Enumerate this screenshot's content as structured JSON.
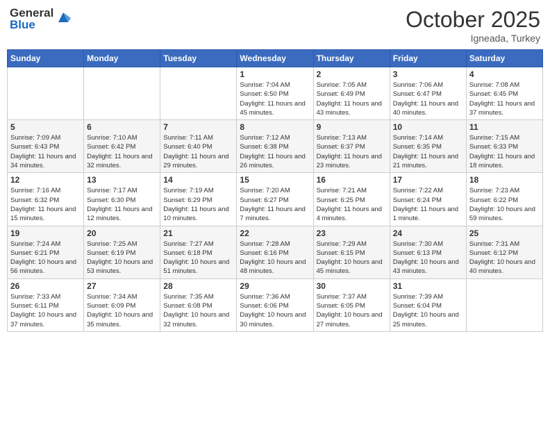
{
  "header": {
    "logo_general": "General",
    "logo_blue": "Blue",
    "month": "October 2025",
    "location": "Igneada, Turkey"
  },
  "weekdays": [
    "Sunday",
    "Monday",
    "Tuesday",
    "Wednesday",
    "Thursday",
    "Friday",
    "Saturday"
  ],
  "weeks": [
    [
      null,
      null,
      null,
      {
        "day": "1",
        "sunrise": "7:04 AM",
        "sunset": "6:50 PM",
        "daylight": "11 hours and 45 minutes."
      },
      {
        "day": "2",
        "sunrise": "7:05 AM",
        "sunset": "6:49 PM",
        "daylight": "11 hours and 43 minutes."
      },
      {
        "day": "3",
        "sunrise": "7:06 AM",
        "sunset": "6:47 PM",
        "daylight": "11 hours and 40 minutes."
      },
      {
        "day": "4",
        "sunrise": "7:08 AM",
        "sunset": "6:45 PM",
        "daylight": "11 hours and 37 minutes."
      }
    ],
    [
      {
        "day": "5",
        "sunrise": "7:09 AM",
        "sunset": "6:43 PM",
        "daylight": "11 hours and 34 minutes."
      },
      {
        "day": "6",
        "sunrise": "7:10 AM",
        "sunset": "6:42 PM",
        "daylight": "11 hours and 32 minutes."
      },
      {
        "day": "7",
        "sunrise": "7:11 AM",
        "sunset": "6:40 PM",
        "daylight": "11 hours and 29 minutes."
      },
      {
        "day": "8",
        "sunrise": "7:12 AM",
        "sunset": "6:38 PM",
        "daylight": "11 hours and 26 minutes."
      },
      {
        "day": "9",
        "sunrise": "7:13 AM",
        "sunset": "6:37 PM",
        "daylight": "11 hours and 23 minutes."
      },
      {
        "day": "10",
        "sunrise": "7:14 AM",
        "sunset": "6:35 PM",
        "daylight": "11 hours and 21 minutes."
      },
      {
        "day": "11",
        "sunrise": "7:15 AM",
        "sunset": "6:33 PM",
        "daylight": "11 hours and 18 minutes."
      }
    ],
    [
      {
        "day": "12",
        "sunrise": "7:16 AM",
        "sunset": "6:32 PM",
        "daylight": "11 hours and 15 minutes."
      },
      {
        "day": "13",
        "sunrise": "7:17 AM",
        "sunset": "6:30 PM",
        "daylight": "11 hours and 12 minutes."
      },
      {
        "day": "14",
        "sunrise": "7:19 AM",
        "sunset": "6:29 PM",
        "daylight": "11 hours and 10 minutes."
      },
      {
        "day": "15",
        "sunrise": "7:20 AM",
        "sunset": "6:27 PM",
        "daylight": "11 hours and 7 minutes."
      },
      {
        "day": "16",
        "sunrise": "7:21 AM",
        "sunset": "6:25 PM",
        "daylight": "11 hours and 4 minutes."
      },
      {
        "day": "17",
        "sunrise": "7:22 AM",
        "sunset": "6:24 PM",
        "daylight": "11 hours and 1 minute."
      },
      {
        "day": "18",
        "sunrise": "7:23 AM",
        "sunset": "6:22 PM",
        "daylight": "10 hours and 59 minutes."
      }
    ],
    [
      {
        "day": "19",
        "sunrise": "7:24 AM",
        "sunset": "6:21 PM",
        "daylight": "10 hours and 56 minutes."
      },
      {
        "day": "20",
        "sunrise": "7:25 AM",
        "sunset": "6:19 PM",
        "daylight": "10 hours and 53 minutes."
      },
      {
        "day": "21",
        "sunrise": "7:27 AM",
        "sunset": "6:18 PM",
        "daylight": "10 hours and 51 minutes."
      },
      {
        "day": "22",
        "sunrise": "7:28 AM",
        "sunset": "6:16 PM",
        "daylight": "10 hours and 48 minutes."
      },
      {
        "day": "23",
        "sunrise": "7:29 AM",
        "sunset": "6:15 PM",
        "daylight": "10 hours and 45 minutes."
      },
      {
        "day": "24",
        "sunrise": "7:30 AM",
        "sunset": "6:13 PM",
        "daylight": "10 hours and 43 minutes."
      },
      {
        "day": "25",
        "sunrise": "7:31 AM",
        "sunset": "6:12 PM",
        "daylight": "10 hours and 40 minutes."
      }
    ],
    [
      {
        "day": "26",
        "sunrise": "7:33 AM",
        "sunset": "6:11 PM",
        "daylight": "10 hours and 37 minutes."
      },
      {
        "day": "27",
        "sunrise": "7:34 AM",
        "sunset": "6:09 PM",
        "daylight": "10 hours and 35 minutes."
      },
      {
        "day": "28",
        "sunrise": "7:35 AM",
        "sunset": "6:08 PM",
        "daylight": "10 hours and 32 minutes."
      },
      {
        "day": "29",
        "sunrise": "7:36 AM",
        "sunset": "6:06 PM",
        "daylight": "10 hours and 30 minutes."
      },
      {
        "day": "30",
        "sunrise": "7:37 AM",
        "sunset": "6:05 PM",
        "daylight": "10 hours and 27 minutes."
      },
      {
        "day": "31",
        "sunrise": "7:39 AM",
        "sunset": "6:04 PM",
        "daylight": "10 hours and 25 minutes."
      },
      null
    ]
  ]
}
